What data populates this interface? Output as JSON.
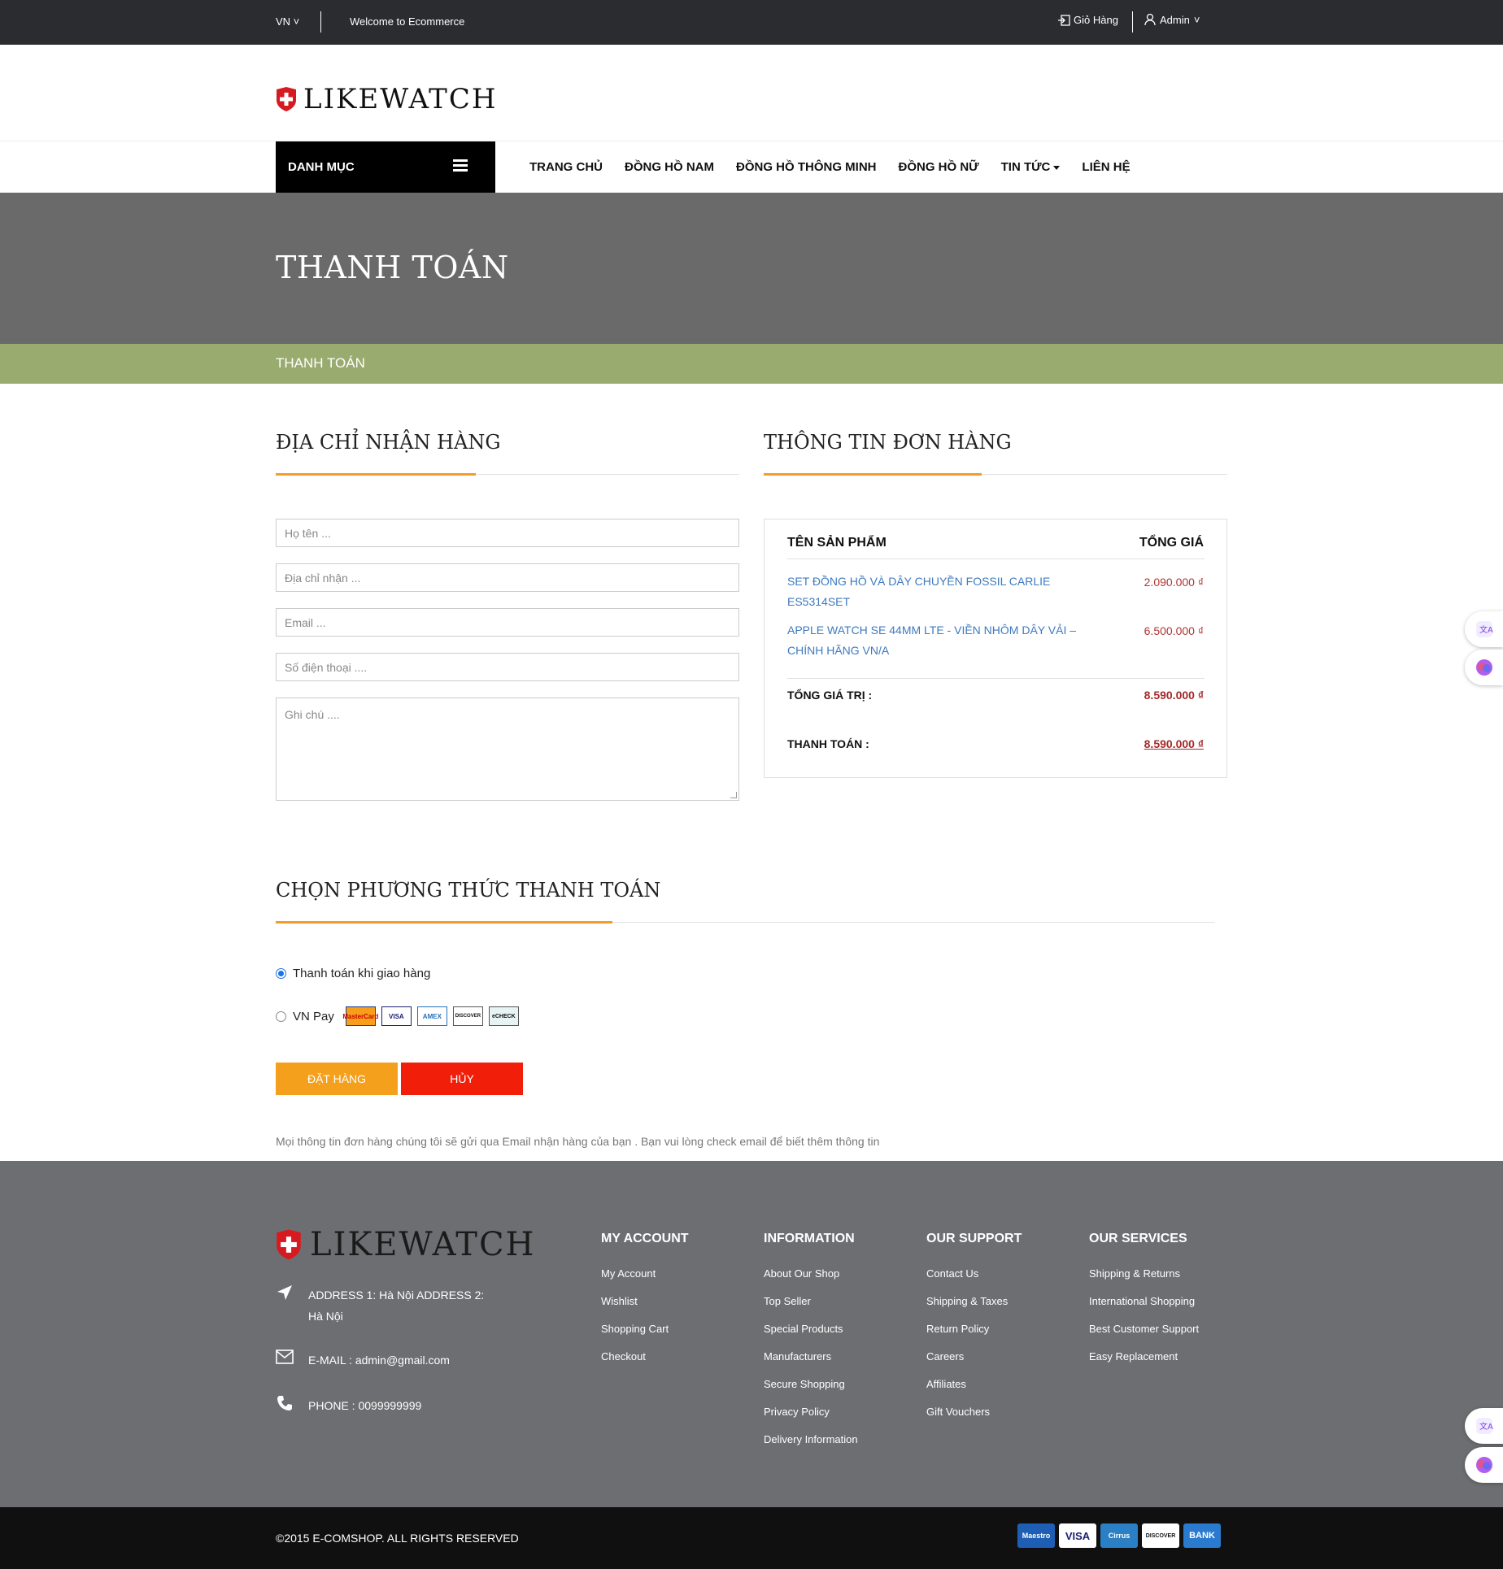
{
  "topbar": {
    "lang": "VN",
    "welcome": "Welcome to Ecommerce",
    "cart": "Giỏ Hàng",
    "admin": "Admin"
  },
  "logo": {
    "brand": "LIKEWATCH"
  },
  "nav": {
    "category": "DANH MỤC",
    "items": [
      "TRANG CHỦ",
      "ĐỒNG HỒ NAM",
      "ĐỒNG HỒ THÔNG MINH",
      "ĐỒNG HỒ NỮ",
      "TIN TỨC",
      "LIÊN HỆ"
    ]
  },
  "hero": {
    "title": "THANH TOÁN",
    "breadcrumb": "THANH TOÁN"
  },
  "address": {
    "title": "ĐỊA CHỈ NHẬN HÀNG",
    "name_placeholder": "Họ tên ...",
    "address_placeholder": "Địa chỉ nhận ...",
    "email_placeholder": "Email ...",
    "phone_placeholder": "Số điện thoại ....",
    "note_placeholder": "Ghi chú ...."
  },
  "order": {
    "title": "THÔNG TIN ĐƠN HÀNG",
    "col_product": "TÊN SẢN PHẨM",
    "col_total": "TỔNG GIÁ",
    "products": [
      {
        "name": "SET ĐỒNG HỒ VÀ DÂY CHUYỀN FOSSIL CARLIE ES5314SET",
        "price": "2.090.000 ₫"
      },
      {
        "name": "APPLE WATCH SE 44MM LTE - VIỀN NHÔM DÂY VẢI – CHÍNH HÃNG VN/A",
        "price": "6.500.000 ₫"
      }
    ],
    "total_label": "TỔNG GIÁ TRỊ :",
    "total_value": "8.590.000 ₫",
    "pay_label": "THANH TOÁN :",
    "pay_value": "8.590.000 ₫"
  },
  "payment": {
    "title": "CHỌN PHƯƠNG THỨC THANH TOÁN",
    "cod": "Thanh toán khi giao hàng",
    "vnpay": "VN Pay",
    "cards": [
      "MasterCard",
      "VISA",
      "AMEX",
      "DISCOVER",
      "eCHECK"
    ],
    "order_button": "ĐẶT HÀNG",
    "cancel_button": "HỦY",
    "note": "Mọi thông tin đơn hàng chúng tôi sẽ gửi qua Email nhận hàng của bạn . Bạn vui lòng check email để biết thêm thông tin"
  },
  "footer": {
    "brand": "LIKEWATCH",
    "address": "ADDRESS 1: Hà Nội ADDRESS 2: Hà Nội",
    "email": "E-MAIL : admin@gmail.com",
    "phone": "PHONE : 0099999999",
    "columns": [
      {
        "title": "MY ACCOUNT",
        "links": [
          "My Account",
          "Wishlist",
          "Shopping Cart",
          "Checkout"
        ]
      },
      {
        "title": "INFORMATION",
        "links": [
          "About Our Shop",
          "Top Seller",
          "Special Products",
          "Manufacturers",
          "Secure Shopping",
          "Privacy Policy",
          "Delivery Information"
        ]
      },
      {
        "title": "OUR SUPPORT",
        "links": [
          "Contact Us",
          "Shipping & Taxes",
          "Return Policy",
          "Careers",
          "Affiliates",
          "Gift Vouchers"
        ]
      },
      {
        "title": "OUR SERVICES",
        "links": [
          "Shipping & Returns",
          "International Shopping",
          "Best Customer Support",
          "Easy Replacement"
        ]
      }
    ],
    "copyright": "©2015 E-COMSHOP. ALL RIGHTS RESERVED",
    "payment_logos": [
      "Maestro",
      "VISA",
      "Cirrus",
      "DISCOVER",
      "BANK"
    ]
  },
  "colors": {
    "accent": "#f39c2a",
    "breadcrumb_bar": "#9aab6f",
    "order_button": "#f4a01c",
    "cancel_button": "#f11f0a"
  }
}
